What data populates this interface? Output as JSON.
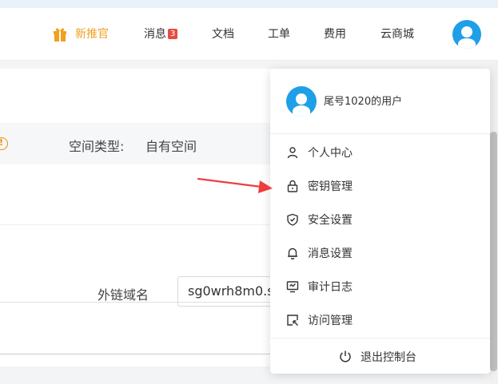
{
  "nav": {
    "promo_label": "新推官",
    "messages_label": "消息",
    "messages_badge": "3",
    "docs_label": "文档",
    "tickets_label": "工单",
    "billing_label": "费用",
    "market_label": "云商城"
  },
  "colors": {
    "accent": "#1e9fe8",
    "promo": "#f0a020",
    "badge": "#e54d42",
    "arrow": "#ee3d3d"
  },
  "content": {
    "space_type_label": "空间类型:",
    "space_type_value": "自有空间",
    "domain_label": "外链域名",
    "domain_value": "sg0wrh8m0.s"
  },
  "dropdown": {
    "username": "尾号1020的用户",
    "items": [
      {
        "label": "个人中心",
        "icon": "user-icon"
      },
      {
        "label": "密钥管理",
        "icon": "lock-icon"
      },
      {
        "label": "安全设置",
        "icon": "shield-icon"
      },
      {
        "label": "消息设置",
        "icon": "bell-icon"
      },
      {
        "label": "审计日志",
        "icon": "monitor-icon"
      },
      {
        "label": "访问管理",
        "icon": "access-icon"
      }
    ],
    "logout_label": "退出控制台"
  }
}
